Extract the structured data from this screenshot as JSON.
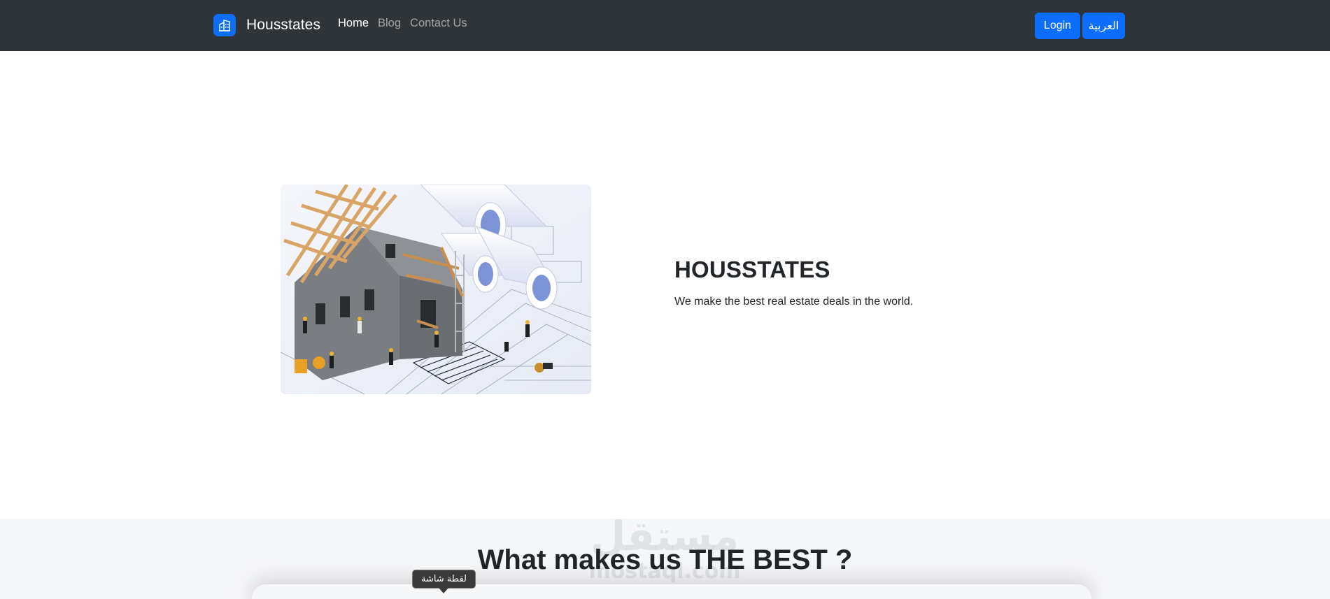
{
  "navbar": {
    "brand_name": "Housstates",
    "links": [
      {
        "label": "Home",
        "active": true
      },
      {
        "label": "Blog",
        "active": false
      },
      {
        "label": "Contact Us",
        "active": false
      }
    ],
    "login_label": "Login",
    "language_label": "العربية"
  },
  "hero": {
    "title": "HOUSSTATES",
    "subtitle": "We make the best real estate deals in the world."
  },
  "section": {
    "title": "What makes us THE BEST ?"
  },
  "overlay": {
    "watermark_text": "مستقل",
    "watermark_url": "mostaql.com",
    "tooltip_text": "لقطة شاشة"
  },
  "colors": {
    "navbar_bg": "#2f3439",
    "primary": "#0d6efd",
    "section_bg": "#f6f7f9"
  },
  "icons": {
    "brand": "building-icon"
  }
}
